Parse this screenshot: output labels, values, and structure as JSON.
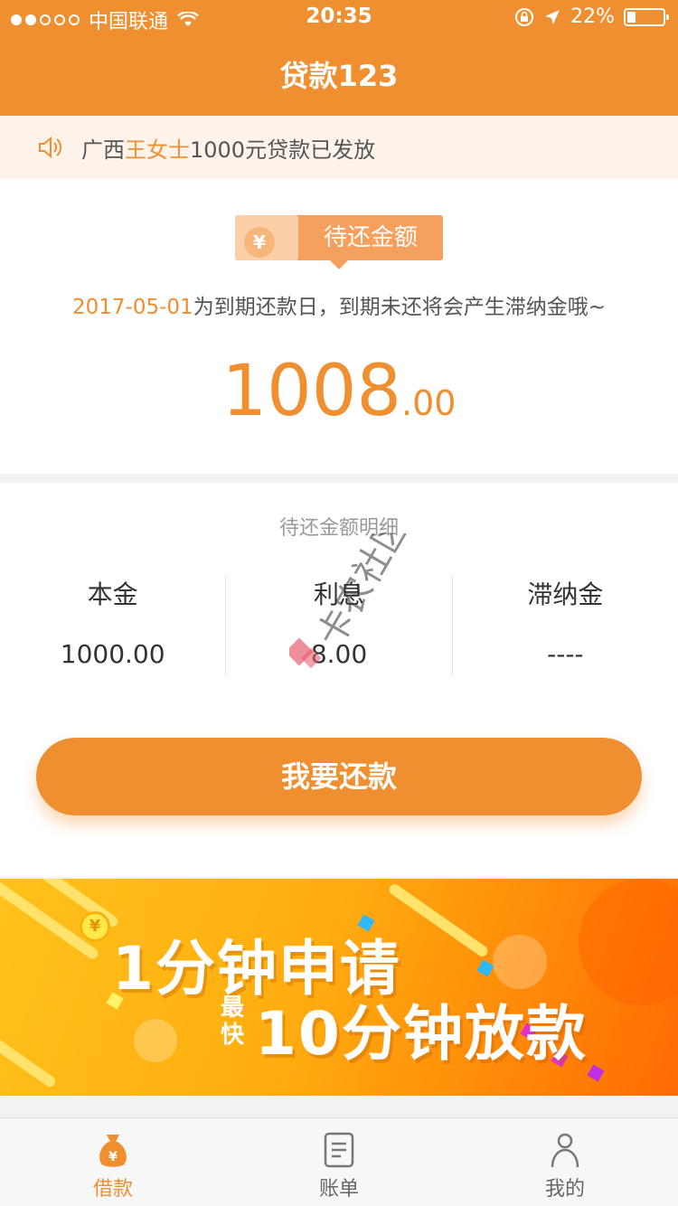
{
  "status_bar": {
    "carrier": "中国联通",
    "time": "20:35",
    "battery": "22%"
  },
  "nav": {
    "title": "贷款123"
  },
  "notice": {
    "prefix": "广西",
    "highlight": "王女士",
    "suffix": "1000元贷款已发放"
  },
  "due": {
    "tag_label": "待还金额",
    "coin_symbol": "¥",
    "date": "2017-05-01",
    "note": "为到期还款日，到期未还将会产生滞纳金哦~",
    "amount_int": "1008",
    "amount_dec": ".00"
  },
  "detail": {
    "title": "待还金额明细",
    "columns": [
      {
        "label": "本金",
        "value": "1000.00"
      },
      {
        "label": "利息",
        "value": "8.00"
      },
      {
        "label": "滞纳金",
        "value": "----"
      }
    ],
    "repay_button": "我要还款"
  },
  "banner": {
    "line1": "1分钟申请",
    "fast": "最快",
    "line2": "10分钟放款",
    "coin_symbol": "¥"
  },
  "tabs": [
    {
      "label": "借款",
      "icon": "money-bag-icon",
      "active": true
    },
    {
      "label": "账单",
      "icon": "bill-icon",
      "active": false
    },
    {
      "label": "我的",
      "icon": "person-icon",
      "active": false
    }
  ],
  "colors": {
    "brand": "#f08f2f",
    "notice_bg": "#fdf3eb"
  }
}
